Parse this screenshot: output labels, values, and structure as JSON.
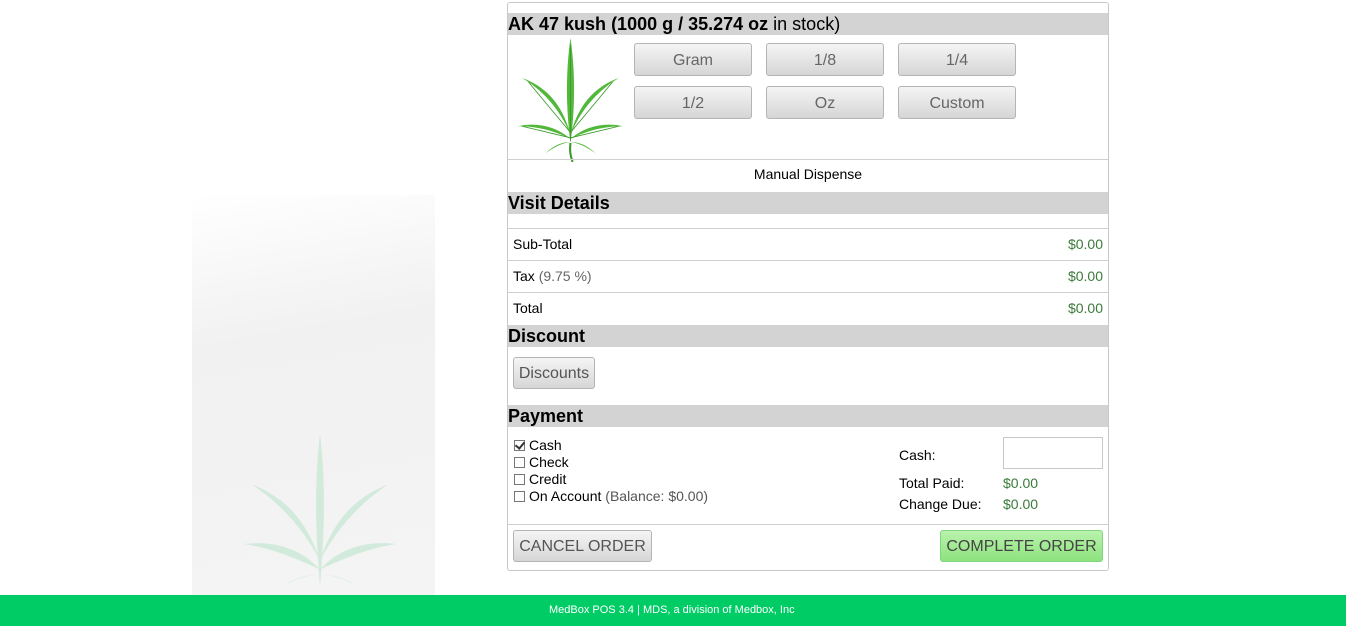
{
  "product": {
    "name": "AK 47 kush",
    "stock_grams": "(1000 g / 35.274 oz",
    "stock_suffix": "in stock)"
  },
  "quantity_buttons": [
    "Gram",
    "1/8",
    "1/4",
    "1/2",
    "Oz",
    "Custom"
  ],
  "manual_dispense": "Manual Dispense",
  "visit_details": {
    "title": "Visit Details",
    "subtotal_label": "Sub-Total",
    "subtotal_value": "$0.00",
    "tax_label": "Tax",
    "tax_rate": "(9.75 %)",
    "tax_value": "$0.00",
    "total_label": "Total",
    "total_value": "$0.00"
  },
  "discount": {
    "title": "Discount",
    "button_label": "Discounts"
  },
  "payment": {
    "title": "Payment",
    "methods": [
      {
        "label": "Cash",
        "checked": true
      },
      {
        "label": "Check",
        "checked": false
      },
      {
        "label": "Credit",
        "checked": false
      },
      {
        "label": "On Account",
        "checked": false
      }
    ],
    "balance_text": "(Balance: $0.00)",
    "cash_label": "Cash:",
    "cash_value": "",
    "total_paid_label": "Total Paid:",
    "total_paid_value": "$0.00",
    "change_due_label": "Change Due:",
    "change_due_value": "$0.00"
  },
  "actions": {
    "cancel_label": "CANCEL ORDER",
    "complete_label": "COMPLETE ORDER"
  },
  "footer": {
    "text": "MedBox POS 3.4 | MDS, a division of Medbox, Inc"
  },
  "icons": {
    "product_image": "cannabis-leaf-icon",
    "background_watermark": "cannabis-leaf-icon"
  },
  "colors": {
    "section_header": "#d3d3d3",
    "money_green": "#3a7a3a",
    "complete_button": "#9ee88e",
    "footer": "#00cc66"
  }
}
